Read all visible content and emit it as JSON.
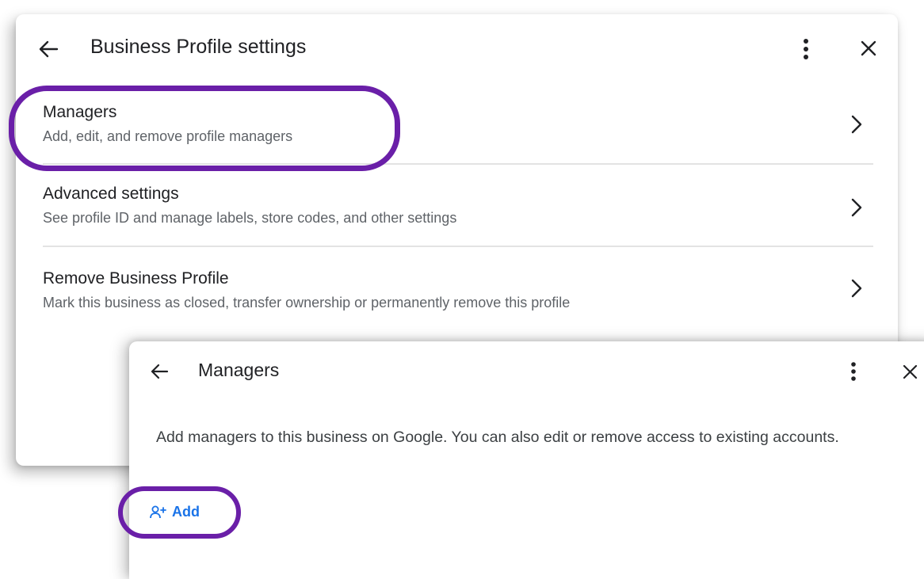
{
  "settings_panel": {
    "title": "Business Profile settings",
    "rows": [
      {
        "title": "Managers",
        "subtitle": "Add, edit, and remove profile managers"
      },
      {
        "title": "Advanced settings",
        "subtitle": "See profile ID and manage labels, store codes, and other settings"
      },
      {
        "title": "Remove Business Profile",
        "subtitle": "Mark this business as closed, transfer ownership or permanently remove this profile"
      }
    ]
  },
  "managers_panel": {
    "title": "Managers",
    "description": "Add managers to this business on Google. You can also edit or remove access to existing accounts.",
    "add_label": "Add"
  },
  "icons": {
    "back": "arrow-left-icon",
    "menu": "more-vert-icon",
    "close": "close-icon",
    "chevron": "chevron-right-icon",
    "add_person": "person-add-icon"
  },
  "colors": {
    "highlight": "#6a1fa8",
    "link": "#1a73e8",
    "primary_text": "#202124",
    "secondary_text": "#5f6368"
  }
}
